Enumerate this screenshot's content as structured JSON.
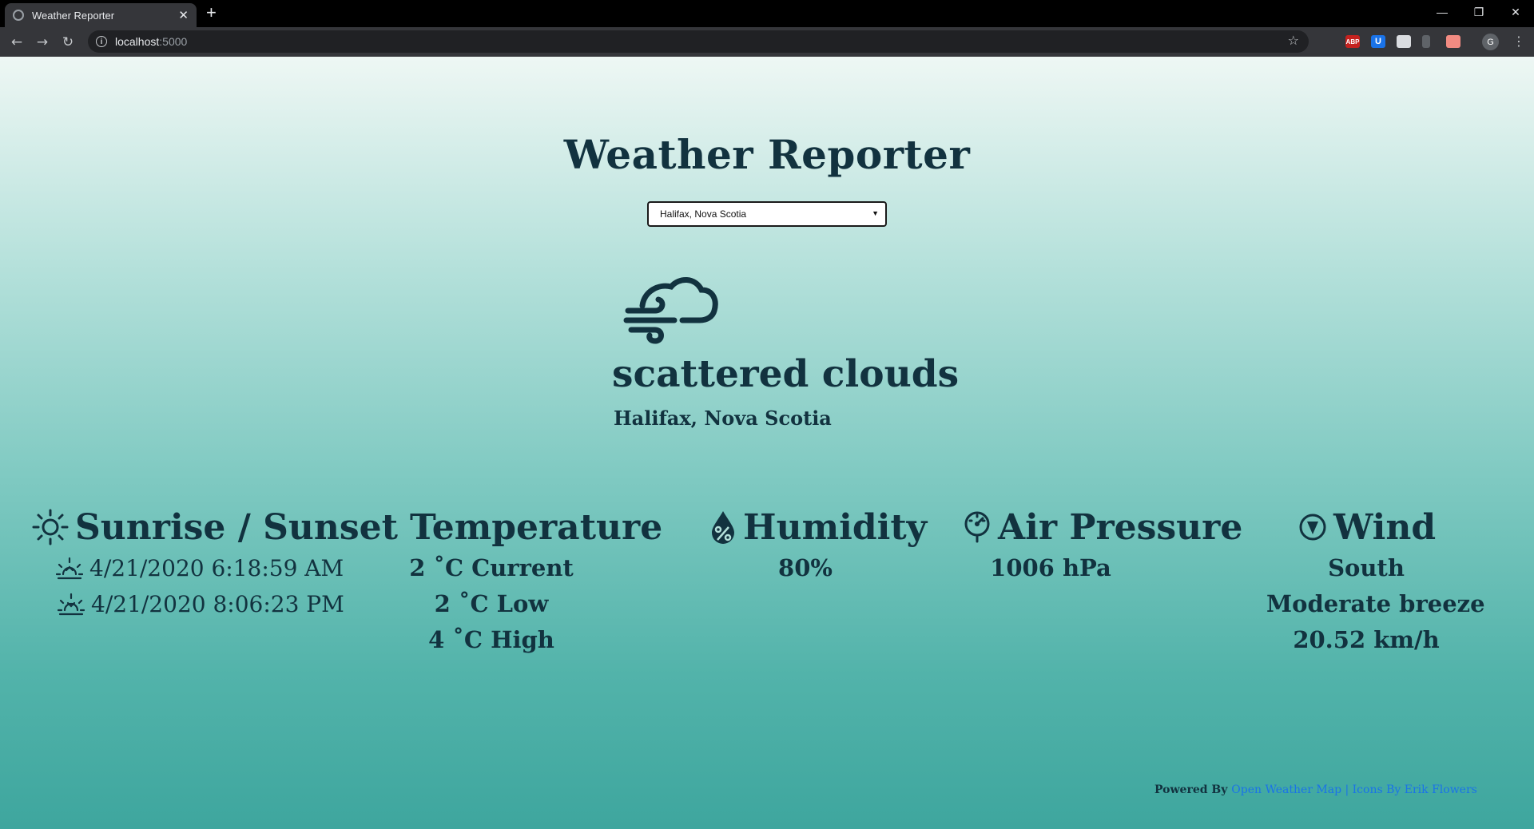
{
  "browser": {
    "tab_title": "Weather Reporter",
    "tab_close": "✕",
    "new_tab": "+",
    "url_host": "localhost",
    "url_port": ":5000",
    "profile_initial": "G",
    "extensions": [
      "ABP",
      "U"
    ]
  },
  "app": {
    "title": "Weather Reporter",
    "selected_city": "Halifax, Nova Scotia",
    "icon": "wind-cloud-icon",
    "description": "scattered clouds",
    "location": "Halifax, Nova Scotia"
  },
  "sun": {
    "heading": "Sunrise / Sunset",
    "sunrise": "4/21/2020 6:18:59 AM",
    "sunset": "4/21/2020 8:06:23 PM"
  },
  "temperature": {
    "heading": "Temperature",
    "current": "2 ˚C Current",
    "low": "2 ˚C Low",
    "high": "4 ˚C High"
  },
  "humidity": {
    "heading": "Humidity",
    "value": "80%"
  },
  "pressure": {
    "heading": "Air Pressure",
    "value": "1006 hPa"
  },
  "wind": {
    "heading": "Wind",
    "direction": "South",
    "description": "Moderate breeze",
    "speed": "20.52 km/h"
  },
  "footer": {
    "powered_by": "Powered By ",
    "link_text": "Open Weather Map | Icons By Erik Flowers"
  },
  "colors": {
    "text": "#12323f",
    "gradient_top": "#eef7f4",
    "gradient_bottom": "#3ea69e",
    "link": "#1a73e8"
  }
}
